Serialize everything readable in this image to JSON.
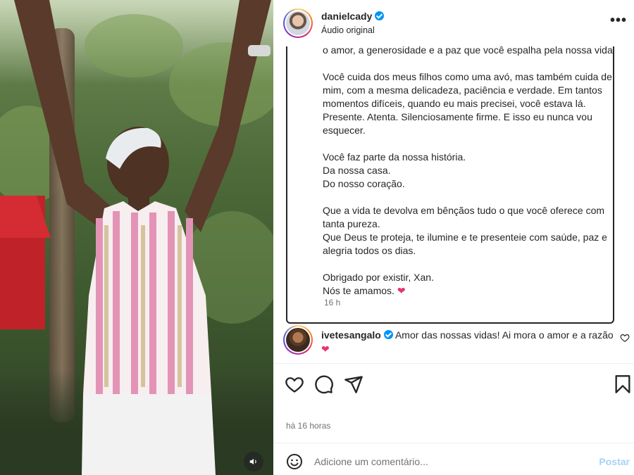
{
  "header": {
    "username": "danielcady",
    "subtitle": "Áudio original",
    "more_label": "•••"
  },
  "caption": {
    "line1": "o amor, a generosidade e a paz que você espalha pela nossa vida.",
    "p1": "Você cuida dos meus filhos como uma avó, mas também cuida de mim, com a mesma delicadeza, paciência e verdade. Em tantos momentos difíceis, quando eu mais precisei, você estava lá. Presente. Atenta. Silenciosamente firme. E isso eu nunca vou esquecer.",
    "p2a": "Você faz parte da nossa história.",
    "p2b": "Da nossa casa.",
    "p2c": "Do nosso coração.",
    "p3a": "Que a vida te devolva em bênçãos tudo o que você oferece com tanta pureza.",
    "p3b": "Que Deus te proteja, te ilumine e te presenteie com saúde, paz e alegria todos os dias.",
    "p4a": "Obrigado por existir, Xan.",
    "p4b": "Nós te amamos.",
    "heart": "❤",
    "timestamp": "16 h"
  },
  "comment": {
    "username": "ivetesangalo",
    "text": "Amor das nossas vidas! Ai mora o amor e a razão",
    "heart": "❤"
  },
  "actions": {
    "posted_ago": "há 16 horas"
  },
  "add_comment": {
    "placeholder": "Adicione um comentário...",
    "post_label": "Postar"
  },
  "colors": {
    "verified": "#0095f6",
    "post_button": "#a8d2f5",
    "heart": "#e8336a"
  },
  "icons": [
    "verified-badge-icon",
    "more-options-icon",
    "heart-icon",
    "comment-icon",
    "share-icon",
    "bookmark-icon",
    "emoji-icon",
    "speaker-icon"
  ]
}
